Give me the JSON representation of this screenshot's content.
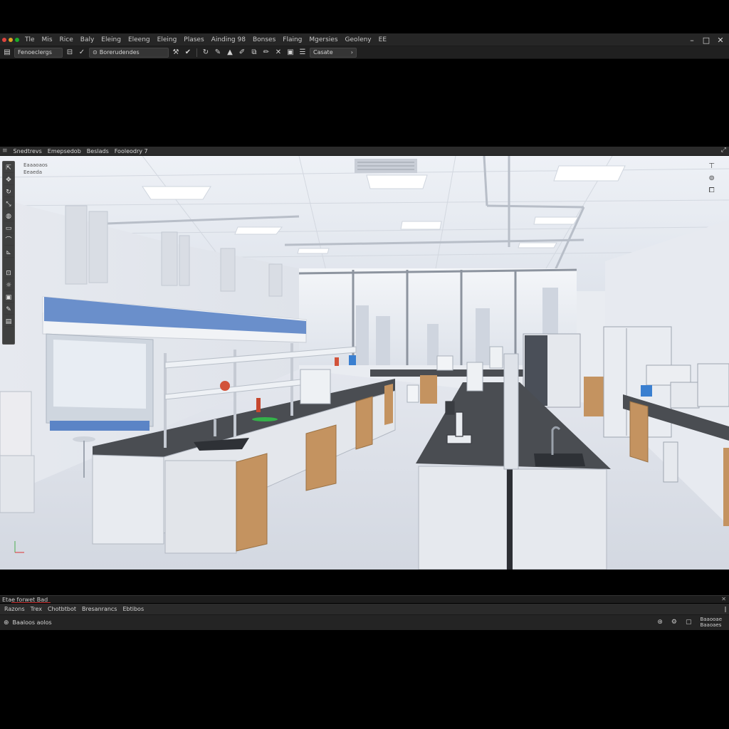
{
  "menubar": {
    "traffic_colors": [
      "#e0443e",
      "#dea123",
      "#1aab29"
    ],
    "items": [
      "Tle",
      "Mis",
      "Rice",
      "Baly",
      "Eleing",
      "Eleeng",
      "Eleing",
      "Plases",
      "Ainding 98",
      "Bonses",
      "Flaing",
      "Mgersies",
      "Geoleny",
      "EE"
    ],
    "window_controls": [
      "–",
      "□",
      "✕"
    ]
  },
  "toolbar": {
    "workspace_field": "Fenoeclergs",
    "search_field": "Borerudendes",
    "mode_field": "Casate",
    "icons": [
      "grid-icon",
      "check-icon",
      "wrench-icon",
      "check-icon",
      "refresh-icon",
      "warning-icon",
      "pencil-icon",
      "edit-icon",
      "pencil-icon",
      "cross-icon",
      "layers-icon",
      "list-icon"
    ]
  },
  "viewport": {
    "tabs": [
      "Snedtrevs",
      "Emepsedob",
      "Beslads",
      "Fooleodry 7"
    ],
    "scene_label_line1": "Eaaaoaos",
    "scene_label_line2": "Eeaeda",
    "left_tools": [
      "select-icon",
      "move-icon",
      "rotate-icon",
      "scale-icon",
      "paint-icon",
      "box-icon",
      "lasso-icon",
      "measure-icon",
      "zoom-icon",
      "light-icon",
      "camera-icon",
      "brush-icon",
      "erase-icon"
    ]
  },
  "bottom_panel": {
    "title": "Etae forwet Bad",
    "close": "✕",
    "tabs": [
      "Razons",
      "Trex",
      "Chotbtbot",
      "Bresanrancs",
      "Ebtibos"
    ]
  },
  "status": {
    "left_text": "Baaloos aolos",
    "readout_line1": "Baaooae",
    "readout_line2": "Baaoaes"
  },
  "colors": {
    "chrome_bg": "#262626",
    "hood_blue": "#5b84c6",
    "cabinet_wood": "#c49360",
    "bench_top": "#4a4d52"
  }
}
